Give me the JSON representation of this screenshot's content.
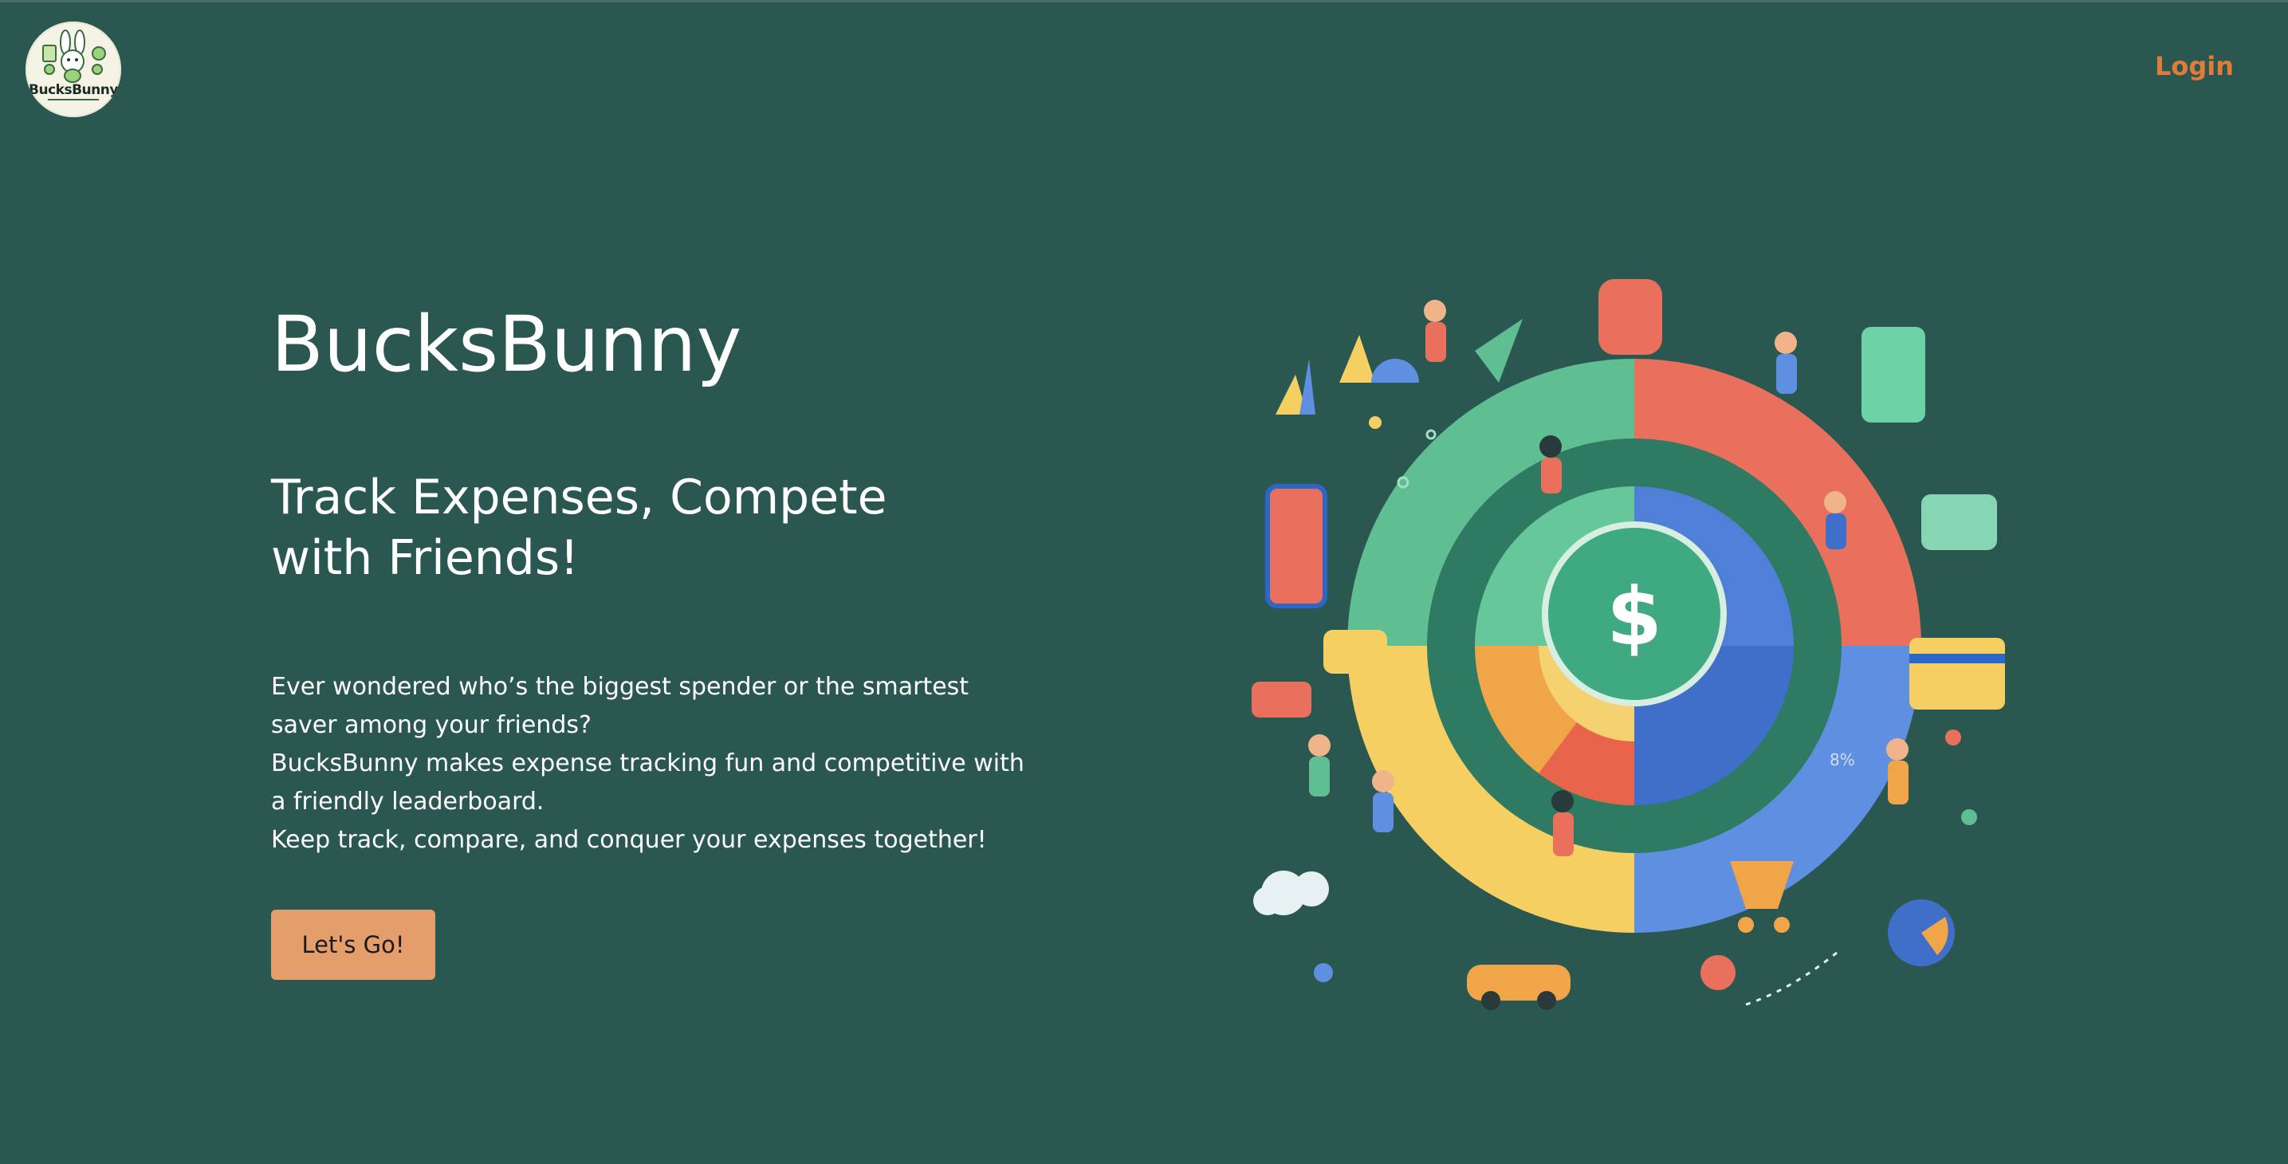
{
  "header": {
    "logo_text": "BucksBunny",
    "login_label": "Login"
  },
  "hero": {
    "title": "BucksBunny",
    "tagline": "Track Expenses, Compete with Friends!",
    "description": [
      "Ever wondered who’s the biggest spender or the smartest saver among your friends?",
      "BucksBunny makes expense tracking fun and competitive with a friendly leaderboard.",
      "Keep track, compare, and conquer your expenses together!"
    ],
    "cta_label": "Let's Go!"
  },
  "illustration": {
    "center_symbol": "$",
    "percent_label": "8%",
    "icons": [
      "dollar-icon",
      "phone-icon",
      "cloud-icon",
      "card-icon",
      "car-icon",
      "cart-icon",
      "wallet-icon",
      "clipboard-icon",
      "heart-icon",
      "pie-chart-icon"
    ]
  },
  "colors": {
    "background": "#2a5850",
    "accent": "#e07c3a",
    "button": "#e39e6c",
    "text": "#ffffff"
  }
}
